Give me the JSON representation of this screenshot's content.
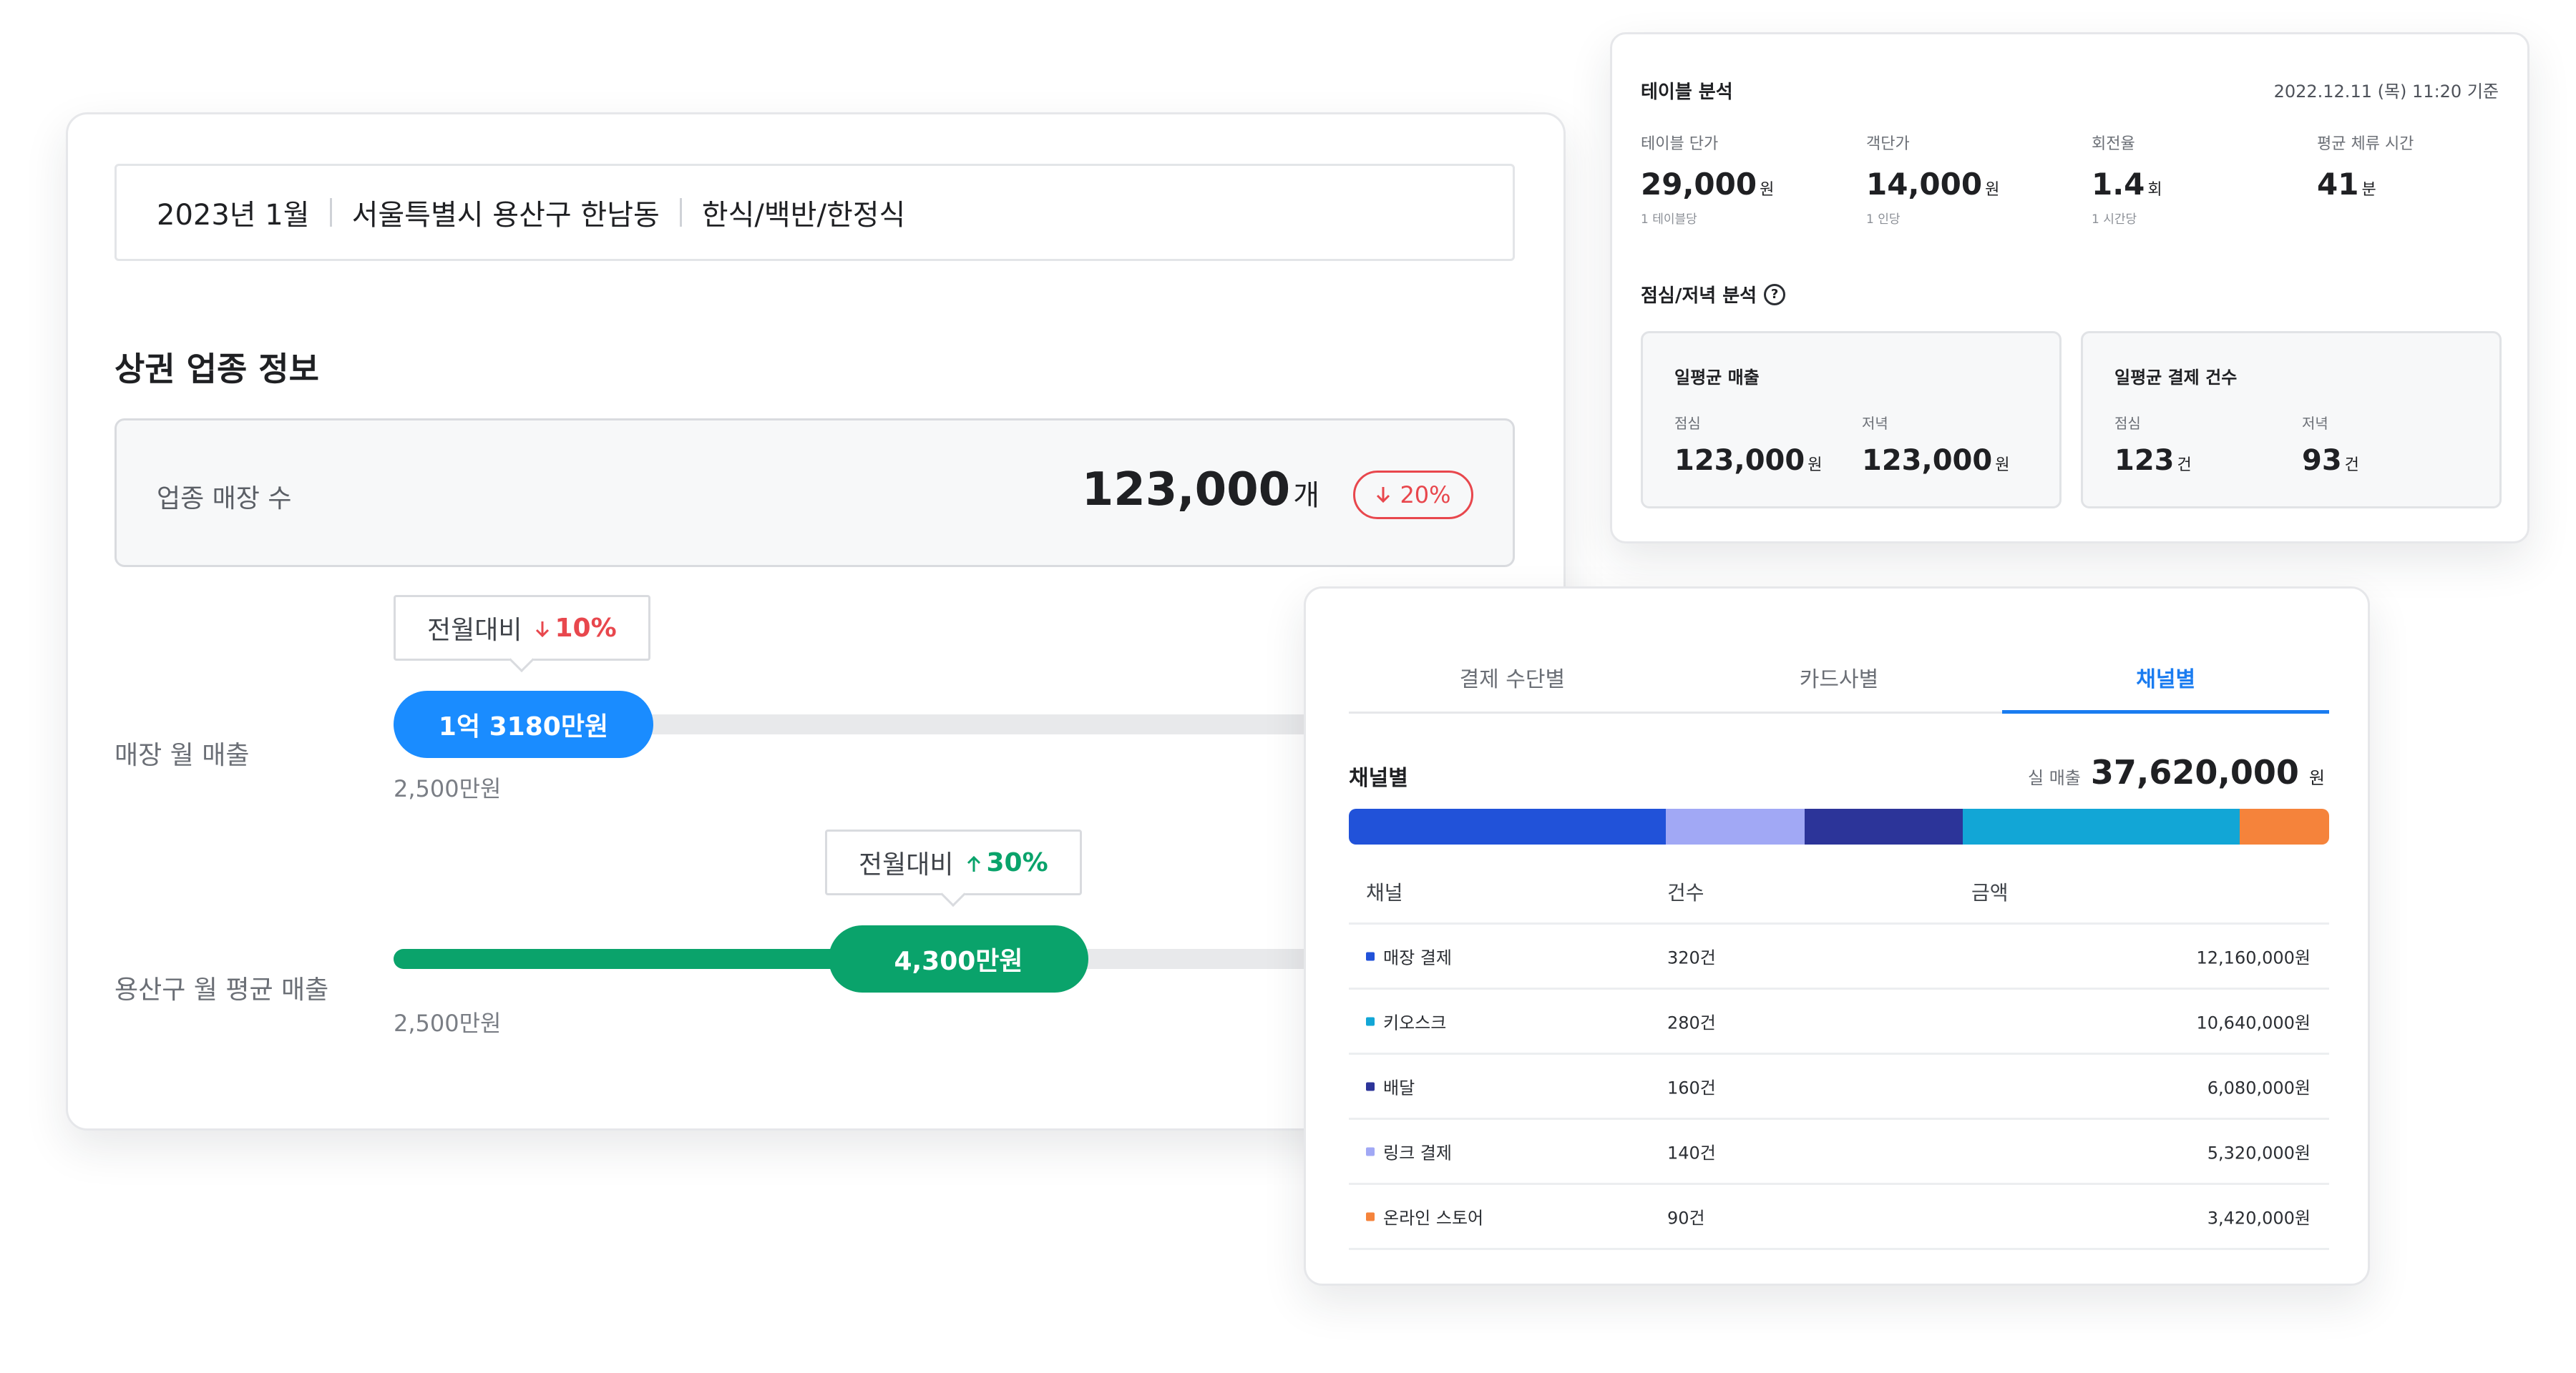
{
  "header": {
    "date": "2023년 1월",
    "location": "서울특별시 용산구 한남동",
    "category": "한식/백반/한정식"
  },
  "section": {
    "title": "상권 업종 정보"
  },
  "store_count": {
    "label": "업종 매장 수",
    "value": "123,000",
    "unit": "개",
    "change": "20%",
    "direction": "down"
  },
  "store_sales": {
    "label": "매장 월 매출",
    "value": "1억 3180만원",
    "min": "2,500만원",
    "compare_label": "전월대비",
    "compare_value": "10%",
    "compare_direction": "down"
  },
  "district_sales": {
    "label": "용산구 월 평균 매출",
    "value": "4,300만원",
    "min": "2,500만원",
    "compare_label": "전월대비",
    "compare_value": "30%",
    "compare_direction": "up"
  },
  "table_analysis": {
    "title": "테이블 분석",
    "timestamp": "2022.12.11 (목) 11:20 기준",
    "kpis": [
      {
        "label": "테이블 단가",
        "value": "29,000",
        "unit": "원",
        "sub": "1 테이블당"
      },
      {
        "label": "객단가",
        "value": "14,000",
        "unit": "원",
        "sub": "1 인당"
      },
      {
        "label": "회전율",
        "value": "1.4",
        "unit": "회",
        "sub": "1 시간당"
      },
      {
        "label": "평균 체류 시간",
        "value": "41",
        "unit": "분",
        "sub": ""
      }
    ],
    "lunch_dinner_title": "점심/저녁 분석",
    "boxes": [
      {
        "title": "일평균 매출",
        "cols": [
          {
            "label": "점심",
            "value": "123,000",
            "unit": "원"
          },
          {
            "label": "저녁",
            "value": "123,000",
            "unit": "원"
          }
        ]
      },
      {
        "title": "일평균 결제 건수",
        "cols": [
          {
            "label": "점심",
            "value": "123",
            "unit": "건"
          },
          {
            "label": "저녁",
            "value": "93",
            "unit": "건"
          }
        ]
      }
    ]
  },
  "channel": {
    "tabs": [
      "결제 수단별",
      "카드사별",
      "채널별"
    ],
    "active_tab": 2,
    "title": "채널별",
    "total_label": "실 매출",
    "total_value": "37,620,000",
    "total_unit": "원",
    "columns": [
      "채널",
      "건수",
      "금액"
    ],
    "rows": [
      {
        "name": "매장 결제",
        "count": "320건",
        "amount": "12,160,000원",
        "amount_value": 12160000,
        "color": "#2152d9"
      },
      {
        "name": "키오스크",
        "count": "280건",
        "amount": "10,640,000원",
        "amount_value": 10640000,
        "color": "#12a6d6"
      },
      {
        "name": "배달",
        "count": "160건",
        "amount": "6,080,000원",
        "amount_value": 6080000,
        "color": "#2c3499"
      },
      {
        "name": "링크 결제",
        "count": "140건",
        "amount": "5,320,000원",
        "amount_value": 5320000,
        "color": "#a1a8f5"
      },
      {
        "name": "온라인 스토어",
        "count": "90건",
        "amount": "3,420,000원",
        "amount_value": 3420000,
        "color": "#f5833b"
      }
    ],
    "bar_order": [
      0,
      3,
      2,
      1,
      4
    ]
  }
}
